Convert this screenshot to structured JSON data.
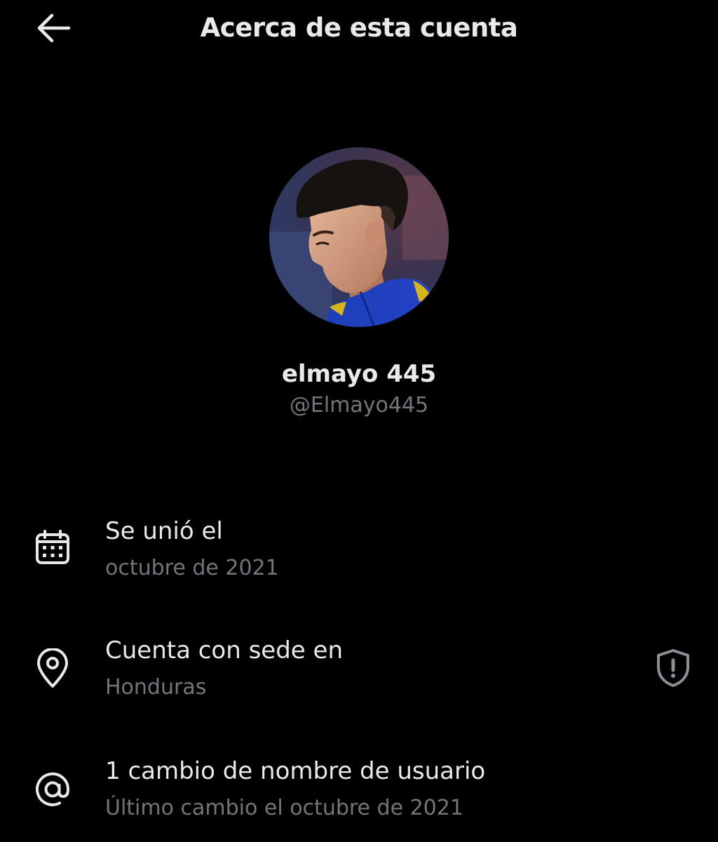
{
  "header": {
    "title": "Acerca de esta cuenta",
    "back_icon": "arrow-left-icon"
  },
  "profile": {
    "display_name": "elmayo 445",
    "handle": "@Elmayo445"
  },
  "details": [
    {
      "icon": "calendar-icon",
      "title": "Se unió el",
      "subtitle": "octubre de 2021"
    },
    {
      "icon": "location-pin-icon",
      "title": "Cuenta con sede en",
      "subtitle": "Honduras",
      "trailing_icon": "shield-alert-icon"
    },
    {
      "icon": "at-sign-icon",
      "title": "1 cambio de nombre de usuario",
      "subtitle": "Último cambio el octubre de 2021"
    }
  ],
  "colors": {
    "background": "#000000",
    "primary_text": "#e7e9ea",
    "secondary_text": "#71767b"
  }
}
